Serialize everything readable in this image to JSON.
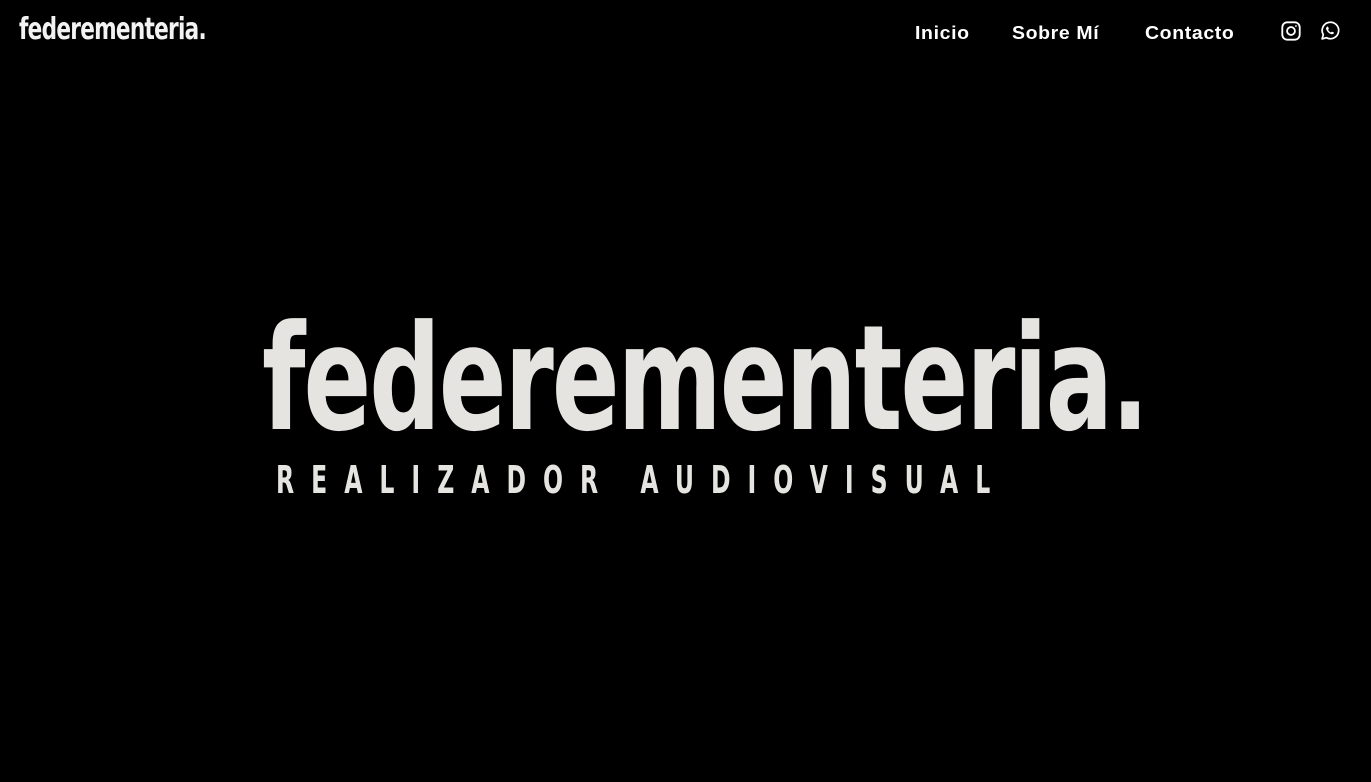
{
  "header": {
    "logo_text": "federementeria.",
    "nav": {
      "inicio": "Inicio",
      "sobre_mi": "Sobre Mí",
      "contacto": "Contacto"
    },
    "social": {
      "instagram_icon": "instagram-icon",
      "whatsapp_icon": "whatsapp-icon"
    }
  },
  "hero": {
    "title": "federementeria.",
    "subtitle": "REALIZADOR AUDIOVISUAL"
  },
  "colors": {
    "background": "#000000",
    "text": "#ffffff",
    "hero_text": "#e6e4e1"
  }
}
